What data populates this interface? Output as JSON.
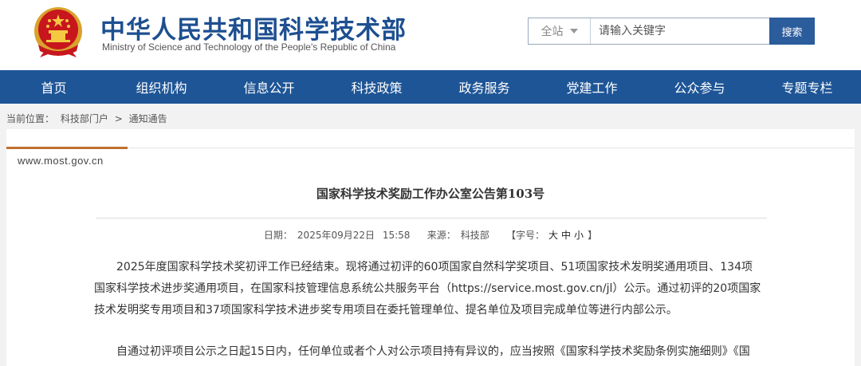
{
  "header": {
    "title": "中华人民共和国科学技术部",
    "subtitle": "Ministry of Science and Technology of the People's Republic of China",
    "emblem_icon": "national-emblem-icon"
  },
  "search": {
    "scope_label": "全站",
    "placeholder": "请输入关键字",
    "button_label": "搜索"
  },
  "nav": {
    "items": [
      "首页",
      "组织机构",
      "信息公开",
      "科技政策",
      "政务服务",
      "党建工作",
      "公众参与",
      "专题专栏"
    ]
  },
  "breadcrumb": {
    "prefix": "当前位置：",
    "items": [
      "科技部门户",
      "通知通告"
    ],
    "separator": ">"
  },
  "article": {
    "domain": "www.most.gov.cn",
    "title": "国家科学技术奖励工作办公室公告第103号",
    "date_label": "日期：",
    "date": "2025年09月22日",
    "time": "15:58",
    "source_label": "来源：",
    "source": "科技部",
    "font_label": "【字号：",
    "font_sizes": [
      "大",
      "中",
      "小"
    ],
    "font_close": "】",
    "p1_lines": [
      "2025年度国家科学技术奖初评工作已经结束。现将通过初评的60项国家自然科学奖项目、51项国家技术发明奖通用项目、134项",
      "国家科学技术进步奖通用项目，在国家科技管理信息系统公共服务平台（https://service.most.gov.cn/jl）公示。通过初评的20项国家",
      "技术发明奖专用项目和37项国家科学技术进步奖专用项目在委托管理单位、提名单位及项目完成单位等进行内部公示。"
    ],
    "p2_lines": [
      "自通过初评项目公示之日起15日内，任何单位或者个人对公示项目持有异议的，应当按照《国家科学技术奖励条例实施细则》《国"
    ]
  },
  "colors": {
    "nav_bg": "#1e5596",
    "title_blue": "#1d4f91",
    "search_button": "#2b5c9c",
    "accent": "#c0702e"
  }
}
